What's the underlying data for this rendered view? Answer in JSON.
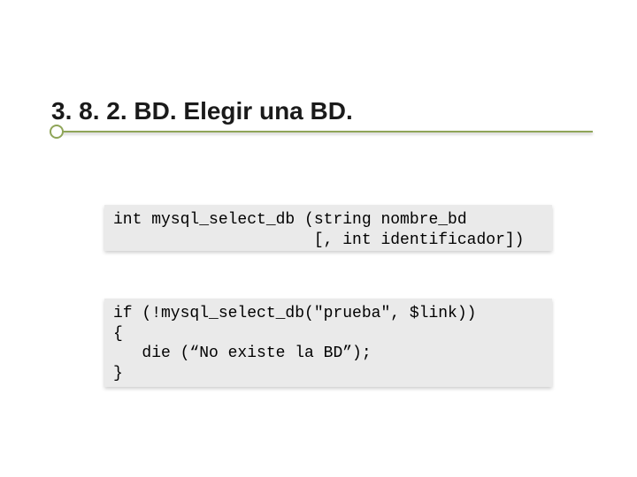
{
  "title": "3. 8. 2. BD. Elegir una BD.",
  "code1": {
    "line1": "int mysql_select_db (string nombre_bd",
    "line2": "                     [, int identificador])"
  },
  "code2": {
    "line1": "if (!mysql_select_db(\"prueba\", $link))",
    "line2": "{",
    "line3": "   die (“No existe la BD”);",
    "line4": "}"
  }
}
